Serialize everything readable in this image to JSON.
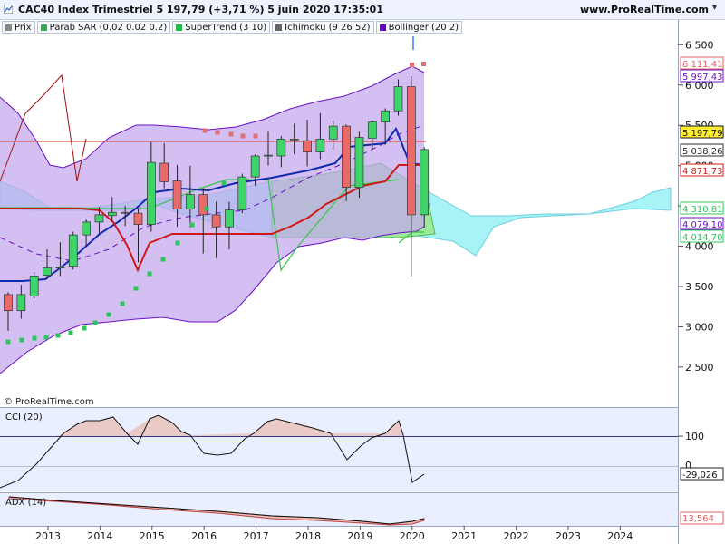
{
  "header": {
    "title": "CAC40 Index Trimestriel 5 197,79 (+3,71 %) 5 juin 2020 17:35:01",
    "site": "www.ProRealTime.com"
  },
  "legend": [
    {
      "label": "Prix",
      "color": "#888888"
    },
    {
      "label": "Parab SAR (0.02 0.02 0.2)",
      "color": "#33aa55"
    },
    {
      "label": "SuperTrend (3 10)",
      "color": "#22bb44"
    },
    {
      "label": "Ichimoku (9 26 52)",
      "color": "#666666"
    },
    {
      "label": "Bollinger (20 2)",
      "color": "#6a00cc"
    }
  ],
  "credit": "© ProRealTime.com",
  "panels": {
    "cci_label": "CCI (20)",
    "adx_label": "ADX (14)"
  },
  "colors": {
    "up_candle": "#3ed46a",
    "down_candle": "#e86b6b",
    "bollinger_fill": "#c3a6ef",
    "bollinger_line": "#6a10c8",
    "kumo_bull": "#9ef2f4",
    "kumo_bear": "#9ee89e",
    "sar_dots": "#2fc45b",
    "sar_top": "#e07070",
    "supertrend": "#36c54d",
    "tenkan": "#102bb0",
    "kijun": "#d01818",
    "chikou": "#a01010",
    "background": "#ffffff",
    "panel_bg": "#e9efff",
    "cci_fill": "#e8c0b8",
    "adx_fill": "#e8c0b8"
  },
  "chart_data": [
    {
      "type": "candlestick",
      "title": "CAC40 Index Trimestriel",
      "y_ticks": [
        2500,
        3000,
        3500,
        4000,
        4500,
        5000,
        5500,
        6000,
        6500
      ],
      "y_tick_labels": [
        "2 500",
        "3 000",
        "3 500",
        "4 000",
        "4 500",
        "5 000",
        "5 500",
        "6 000",
        "6 500"
      ],
      "ylim": [
        2150,
        6650
      ],
      "x_ticks": [
        "2013",
        "2014",
        "2015",
        "2016",
        "2017",
        "2018",
        "2019",
        "2020",
        "2021",
        "2022",
        "2023",
        "2024"
      ],
      "quarters": [
        "2012Q2",
        "2012Q3",
        "2012Q4",
        "2013Q1",
        "2013Q2",
        "2013Q3",
        "2013Q4",
        "2014Q1",
        "2014Q2",
        "2014Q3",
        "2014Q4",
        "2015Q1",
        "2015Q2",
        "2015Q3",
        "2015Q4",
        "2016Q1",
        "2016Q2",
        "2016Q3",
        "2016Q4",
        "2017Q1",
        "2017Q2",
        "2017Q3",
        "2017Q4",
        "2018Q1",
        "2018Q2",
        "2018Q3",
        "2018Q4",
        "2019Q1",
        "2019Q2",
        "2019Q3",
        "2019Q4",
        "2020Q1",
        "2020Q2"
      ],
      "ohlc": [
        [
          3400,
          3430,
          2950,
          3200
        ],
        [
          3200,
          3520,
          3100,
          3400
        ],
        [
          3380,
          3680,
          3350,
          3630
        ],
        [
          3640,
          3960,
          3590,
          3730
        ],
        [
          3730,
          4050,
          3630,
          3740
        ],
        [
          3750,
          4180,
          3710,
          4140
        ],
        [
          4140,
          4330,
          4000,
          4300
        ],
        [
          4300,
          4490,
          4160,
          4390
        ],
        [
          4380,
          4610,
          4300,
          4420
        ],
        [
          4420,
          4500,
          4250,
          4410
        ],
        [
          4410,
          4470,
          3800,
          4270
        ],
        [
          4270,
          5290,
          4180,
          5040
        ],
        [
          5030,
          5280,
          4720,
          4800
        ],
        [
          4810,
          5010,
          4240,
          4460
        ],
        [
          4460,
          5000,
          4230,
          4640
        ],
        [
          4640,
          4720,
          3910,
          4390
        ],
        [
          4390,
          4550,
          3850,
          4240
        ],
        [
          4240,
          4550,
          3960,
          4450
        ],
        [
          4450,
          4900,
          4410,
          4860
        ],
        [
          4860,
          5140,
          4750,
          5120
        ],
        [
          5120,
          5430,
          5000,
          5130
        ],
        [
          5120,
          5370,
          4980,
          5330
        ],
        [
          5330,
          5520,
          5140,
          5320
        ],
        [
          5310,
          5570,
          4990,
          5170
        ],
        [
          5170,
          5650,
          5080,
          5330
        ],
        [
          5330,
          5560,
          5200,
          5490
        ],
        [
          5490,
          5510,
          4560,
          4730
        ],
        [
          4730,
          5420,
          4600,
          5350
        ],
        [
          5340,
          5560,
          5200,
          5540
        ],
        [
          5540,
          5710,
          5260,
          5680
        ],
        [
          5680,
          6070,
          5620,
          5980
        ],
        [
          5980,
          6110,
          3630,
          4390
        ],
        [
          4390,
          5230,
          4230,
          5200
        ]
      ],
      "last_price": "5 197,79",
      "price_labels": [
        {
          "text": "6 111,41",
          "color": "#e06060"
        },
        {
          "text": "5 997,43",
          "color": "#6a10c8"
        },
        {
          "text": "5 197,79",
          "color": "#111111"
        },
        {
          "text": "5 038,26",
          "color": "#2a2a2a"
        },
        {
          "text": "4 871,73",
          "color": "#d01818"
        },
        {
          "text": "4 310,81",
          "color": "#2fc45b"
        },
        {
          "text": "4 079,10",
          "color": "#6a10c8"
        },
        {
          "text": "4 014,70",
          "color": "#2fc45b"
        }
      ],
      "grid": false
    },
    {
      "type": "line",
      "title": "CCI (20)",
      "y_ticks": [
        100,
        0
      ],
      "y_tick_labels": [
        "100",
        "0"
      ],
      "last_value": "-29,026"
    },
    {
      "type": "area",
      "title": "ADX (14)",
      "last_value": "13,564"
    }
  ]
}
